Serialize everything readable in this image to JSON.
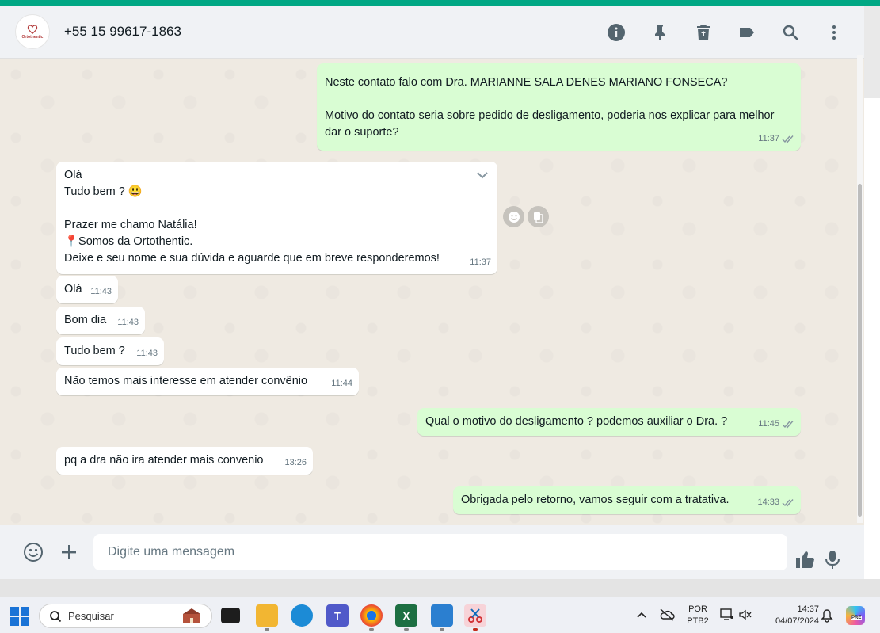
{
  "header": {
    "contact_name": "+55 15 99617-1863",
    "avatar_logo_text": "Ortothentic"
  },
  "messages": [
    {
      "dir": "out",
      "text": "Neste contato falo com Dra. MARIANNE SALA DENES MARIANO FONSECA?\n\nMotivo do contato seria sobre pedido de desligamento, poderia nos explicar para melhor dar o suporte?",
      "time": "11:37"
    },
    {
      "dir": "in",
      "text": "Olá\nTudo bem ? 😃\n\nPrazer me chamo Natália!\n📍Somos da Ortothentic.\nDeixe e seu nome e sua dúvida e aguarde que em breve responderemos!",
      "time": "11:37"
    },
    {
      "dir": "in",
      "text": "Olá",
      "time": "11:43"
    },
    {
      "dir": "in",
      "text": "Bom dia",
      "time": "11:43"
    },
    {
      "dir": "in",
      "text": "Tudo bem ?",
      "time": "11:43"
    },
    {
      "dir": "in",
      "text": "Não temos mais interesse em atender convênio",
      "time": "11:44"
    },
    {
      "dir": "out",
      "text": "Qual o motivo do desligamento ? podemos auxiliar o Dra. ?",
      "time": "11:45"
    },
    {
      "dir": "in",
      "text": "pq a dra não ira atender mais convenio",
      "time": "13:26"
    },
    {
      "dir": "out",
      "text": "Obrigada pelo retorno, vamos seguir com a tratativa.",
      "time": "14:33"
    }
  ],
  "composer": {
    "placeholder": "Digite uma mensagem"
  },
  "taskbar": {
    "search_label": "Pesquisar",
    "lang_top": "POR",
    "lang_bottom": "PTB2",
    "time": "14:37",
    "date": "04/07/2024",
    "copilot_badge": "PRE"
  },
  "colors": {
    "accent": "#00a884",
    "outgoing_bubble": "#d9fdd3",
    "incoming_bubble": "#ffffff",
    "chat_bg": "#efeae2",
    "read_ticks": "#8696a0"
  }
}
